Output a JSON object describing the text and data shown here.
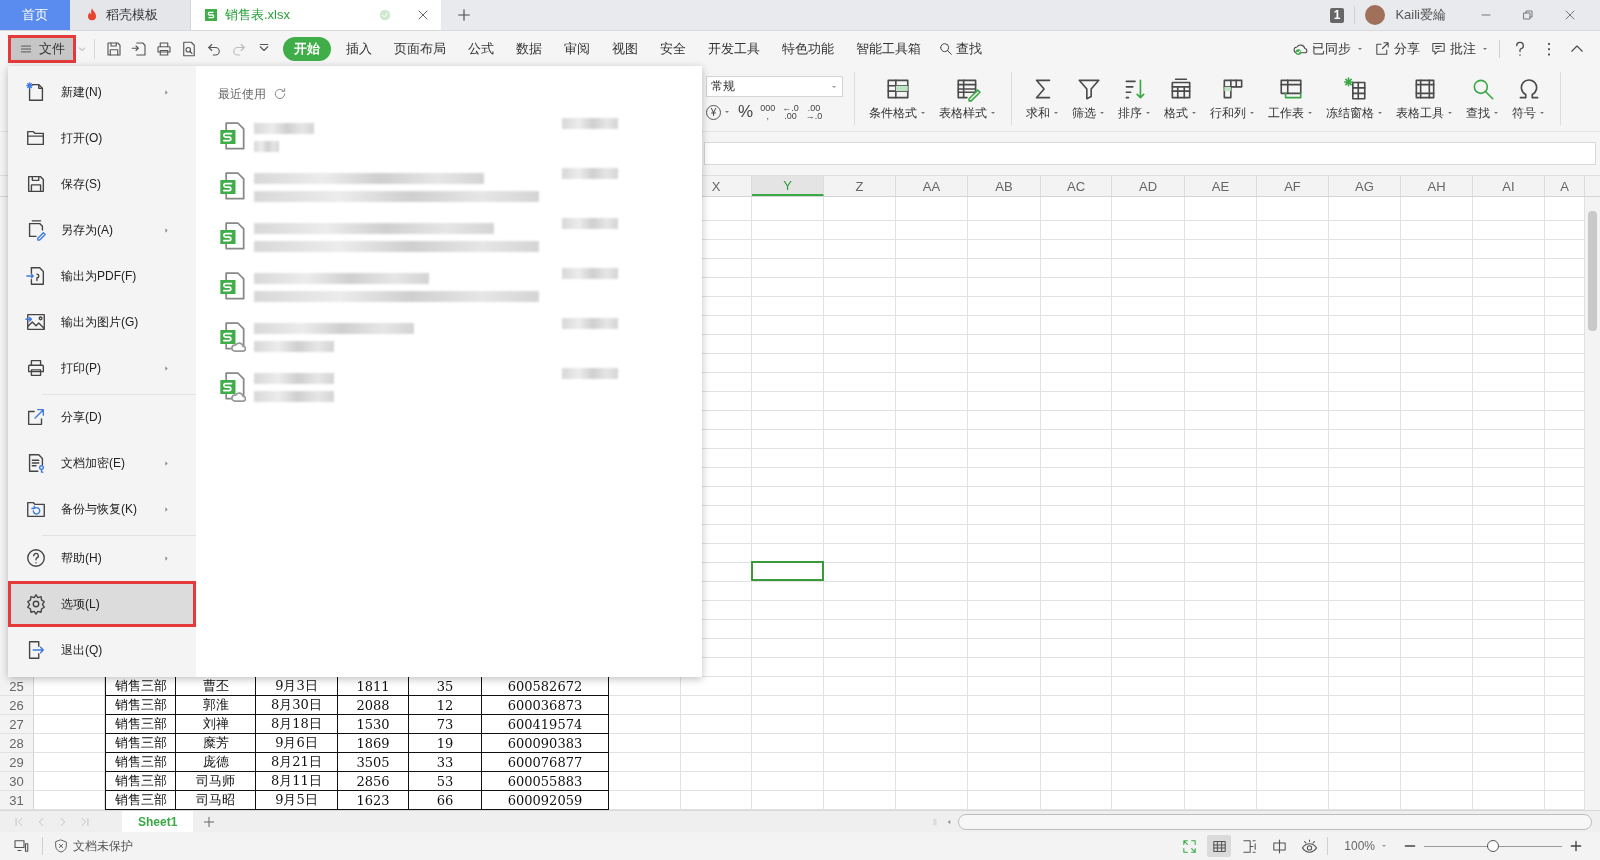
{
  "tabs": [
    {
      "label": "首页",
      "kind": "home",
      "selected": false
    },
    {
      "label": "稻壳模板",
      "kind": "app",
      "selected": false
    },
    {
      "label": "销售表.xlsx",
      "kind": "document",
      "selected": true
    }
  ],
  "window_badge": "1",
  "user": {
    "name": "Kaili爱綸"
  },
  "file_button": {
    "label": "文件",
    "selected": true
  },
  "ribbon_tabs": [
    {
      "label": "开始",
      "selected": true
    },
    {
      "label": "插入",
      "selected": false
    },
    {
      "label": "页面布局",
      "selected": false
    },
    {
      "label": "公式",
      "selected": false
    },
    {
      "label": "数据",
      "selected": false
    },
    {
      "label": "审阅",
      "selected": false
    },
    {
      "label": "视图",
      "selected": false
    },
    {
      "label": "安全",
      "selected": false
    },
    {
      "label": "开发工具",
      "selected": false
    },
    {
      "label": "特色功能",
      "selected": false
    },
    {
      "label": "智能工具箱",
      "selected": false
    }
  ],
  "search_label": "查找",
  "right_actions": [
    {
      "label": "已同步",
      "dropdown": true
    },
    {
      "label": "分享",
      "dropdown": false
    },
    {
      "label": "批注",
      "dropdown": true
    }
  ],
  "ribbon": {
    "number_format": "常规",
    "number_buttons": [
      {
        "kind": "currency",
        "lines": [
          "¥"
        ]
      },
      {
        "kind": "percent",
        "lines": [
          "%"
        ]
      },
      {
        "kind": "thousands",
        "lines": [
          "000",
          ","
        ]
      },
      {
        "kind": "decimal_increase",
        "lines": [
          "←.0",
          ".00"
        ]
      },
      {
        "kind": "decimal_decrease",
        "lines": [
          ".00",
          "→.0"
        ]
      }
    ],
    "style_buttons": [
      {
        "label": "条件格式",
        "dropdown": true
      },
      {
        "label": "表格样式",
        "dropdown": true
      }
    ],
    "tool_buttons": [
      {
        "label": "求和",
        "dropdown": true
      },
      {
        "label": "筛选",
        "dropdown": true
      },
      {
        "label": "排序",
        "dropdown": true
      },
      {
        "label": "格式",
        "dropdown": true
      },
      {
        "label": "行和列",
        "dropdown": true
      },
      {
        "label": "工作表",
        "dropdown": true
      },
      {
        "label": "冻结窗格",
        "dropdown": true
      },
      {
        "label": "表格工具",
        "dropdown": true
      },
      {
        "label": "查找",
        "dropdown": true
      },
      {
        "label": "符号",
        "dropdown": true
      }
    ]
  },
  "columns": [
    {
      "label": "X",
      "selected": false
    },
    {
      "label": "Y",
      "selected": true
    },
    {
      "label": "Z",
      "selected": false
    },
    {
      "label": "AA",
      "selected": false
    },
    {
      "label": "AB",
      "selected": false
    },
    {
      "label": "AC",
      "selected": false
    },
    {
      "label": "AD",
      "selected": false
    },
    {
      "label": "AE",
      "selected": false
    },
    {
      "label": "AF",
      "selected": false
    },
    {
      "label": "AG",
      "selected": false
    },
    {
      "label": "AH",
      "selected": false
    },
    {
      "label": "AI",
      "selected": false
    },
    {
      "label": "A",
      "selected": false
    }
  ],
  "rows": [
    {
      "number": "25",
      "cells": [
        "销售三部",
        "曹丕",
        "9月3日",
        "1811",
        "35",
        "600582672"
      ]
    },
    {
      "number": "26",
      "cells": [
        "销售三部",
        "郭淮",
        "8月30日",
        "2088",
        "12",
        "600036873"
      ]
    },
    {
      "number": "27",
      "cells": [
        "销售三部",
        "刘禅",
        "8月18日",
        "1530",
        "73",
        "600419574"
      ]
    },
    {
      "number": "28",
      "cells": [
        "销售三部",
        "糜芳",
        "9月6日",
        "1869",
        "19",
        "600090383"
      ]
    },
    {
      "number": "29",
      "cells": [
        "销售三部",
        "庞德",
        "8月21日",
        "3505",
        "33",
        "600076877"
      ]
    },
    {
      "number": "30",
      "cells": [
        "销售三部",
        "司马师",
        "8月11日",
        "2856",
        "53",
        "600055883"
      ]
    },
    {
      "number": "31",
      "cells": [
        "销售三部",
        "司马昭",
        "9月5日",
        "1623",
        "66",
        "600092059"
      ]
    }
  ],
  "file_menu": {
    "items": [
      {
        "label": "新建(N)",
        "submenu": true,
        "selected": false,
        "divider_before": false
      },
      {
        "label": "打开(O)",
        "submenu": false,
        "selected": false,
        "divider_before": false
      },
      {
        "label": "保存(S)",
        "submenu": false,
        "selected": false,
        "divider_before": false
      },
      {
        "label": "另存为(A)",
        "submenu": true,
        "selected": false,
        "divider_before": false
      },
      {
        "label": "输出为PDF(F)",
        "submenu": false,
        "selected": false,
        "divider_before": false
      },
      {
        "label": "输出为图片(G)",
        "submenu": false,
        "selected": false,
        "divider_before": false
      },
      {
        "label": "打印(P)",
        "submenu": true,
        "selected": false,
        "divider_before": false
      },
      {
        "label": "分享(D)",
        "submenu": false,
        "selected": false,
        "divider_before": true
      },
      {
        "label": "文档加密(E)",
        "submenu": true,
        "selected": false,
        "divider_before": false
      },
      {
        "label": "备份与恢复(K)",
        "submenu": true,
        "selected": false,
        "divider_before": false
      },
      {
        "label": "帮助(H)",
        "submenu": true,
        "selected": false,
        "divider_before": true
      },
      {
        "label": "选项(L)",
        "submenu": false,
        "selected": true,
        "divider_before": false
      },
      {
        "label": "退出(Q)",
        "submenu": false,
        "selected": false,
        "divider_before": false
      }
    ],
    "recent_title": "最近使用",
    "recent_files": [
      {
        "kind": "local"
      },
      {
        "kind": "local"
      },
      {
        "kind": "local"
      },
      {
        "kind": "local"
      },
      {
        "kind": "cloud"
      },
      {
        "kind": "cloud"
      }
    ]
  },
  "sheets": [
    {
      "label": "Sheet1",
      "selected": true
    }
  ],
  "status": {
    "protection": "文档未保护",
    "view_modes": [
      {
        "selected": false
      },
      {
        "selected": true
      },
      {
        "selected": false
      },
      {
        "selected": false
      },
      {
        "selected": false
      }
    ],
    "zoom": "100%",
    "zoom_slider": {
      "level": 0.5
    }
  }
}
